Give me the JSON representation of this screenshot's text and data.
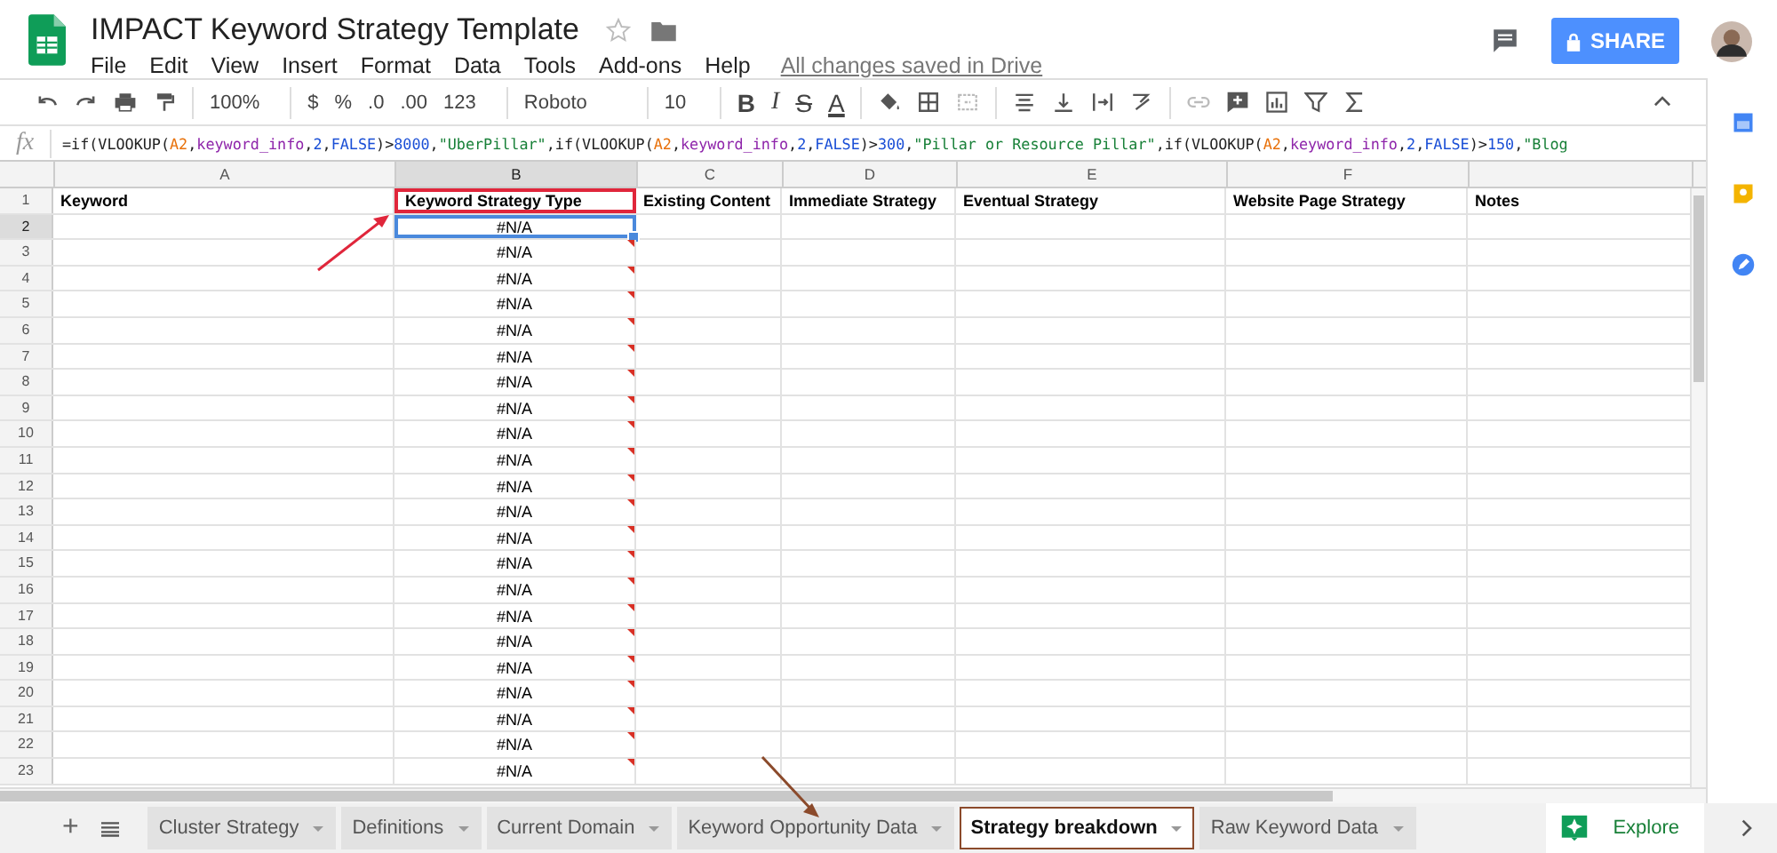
{
  "document": {
    "title": "IMPACT Keyword Strategy Template",
    "save_status": "All changes saved in Drive",
    "starred": false
  },
  "menu": [
    "File",
    "Edit",
    "View",
    "Insert",
    "Format",
    "Data",
    "Tools",
    "Add-ons",
    "Help"
  ],
  "share": {
    "label": "SHARE"
  },
  "toolbar": {
    "zoom": "100%",
    "currency": "$",
    "percent": "%",
    "decrease_decimals": ".0",
    "increase_decimals": ".00",
    "number_format": "123",
    "font": "Roboto",
    "font_size": "10",
    "bold": "B",
    "italic": "I",
    "strikethrough": "S",
    "text_color": "A"
  },
  "formula_bar": {
    "label": "fx",
    "segments": [
      {
        "kind": "plain",
        "text": "=if(VLOOKUP("
      },
      {
        "kind": "ref",
        "text": "A2"
      },
      {
        "kind": "plain",
        "text": ","
      },
      {
        "kind": "name",
        "text": "keyword_info"
      },
      {
        "kind": "plain",
        "text": ","
      },
      {
        "kind": "number",
        "text": "2"
      },
      {
        "kind": "plain",
        "text": ","
      },
      {
        "kind": "number",
        "text": "FALSE"
      },
      {
        "kind": "plain",
        "text": ")>"
      },
      {
        "kind": "number",
        "text": "8000"
      },
      {
        "kind": "plain",
        "text": ","
      },
      {
        "kind": "string",
        "text": "\"UberPillar\""
      },
      {
        "kind": "plain",
        "text": ",if(VLOOKUP("
      },
      {
        "kind": "ref",
        "text": "A2"
      },
      {
        "kind": "plain",
        "text": ","
      },
      {
        "kind": "name",
        "text": "keyword_info"
      },
      {
        "kind": "plain",
        "text": ","
      },
      {
        "kind": "number",
        "text": "2"
      },
      {
        "kind": "plain",
        "text": ","
      },
      {
        "kind": "number",
        "text": "FALSE"
      },
      {
        "kind": "plain",
        "text": ")>"
      },
      {
        "kind": "number",
        "text": "300"
      },
      {
        "kind": "plain",
        "text": ","
      },
      {
        "kind": "string",
        "text": "\"Pillar or Resource Pillar\""
      },
      {
        "kind": "plain",
        "text": ",if(VLOOKUP("
      },
      {
        "kind": "ref",
        "text": "A2"
      },
      {
        "kind": "plain",
        "text": ","
      },
      {
        "kind": "name",
        "text": "keyword_info"
      },
      {
        "kind": "plain",
        "text": ","
      },
      {
        "kind": "number",
        "text": "2"
      },
      {
        "kind": "plain",
        "text": ","
      },
      {
        "kind": "number",
        "text": "FALSE"
      },
      {
        "kind": "plain",
        "text": ")>"
      },
      {
        "kind": "number",
        "text": "150"
      },
      {
        "kind": "plain",
        "text": ","
      },
      {
        "kind": "string",
        "text": "\"Blog"
      }
    ]
  },
  "columns": [
    {
      "letter": "A",
      "selected": false
    },
    {
      "letter": "B",
      "selected": true
    },
    {
      "letter": "C",
      "selected": false
    },
    {
      "letter": "D",
      "selected": false
    },
    {
      "letter": "E",
      "selected": false
    },
    {
      "letter": "F",
      "selected": false
    }
  ],
  "header_row": {
    "number": "1",
    "cells": [
      "Keyword",
      "Keyword Strategy Type",
      "Existing Content",
      "Immediate Strategy",
      "Eventual Strategy",
      "Website Page Strategy",
      "Notes"
    ]
  },
  "rows": [
    {
      "number": "2",
      "value": "#N/A",
      "selected": true,
      "flagged": false
    },
    {
      "number": "3",
      "value": "#N/A",
      "selected": false,
      "flagged": true
    },
    {
      "number": "4",
      "value": "#N/A",
      "selected": false,
      "flagged": true
    },
    {
      "number": "5",
      "value": "#N/A",
      "selected": false,
      "flagged": true
    },
    {
      "number": "6",
      "value": "#N/A",
      "selected": false,
      "flagged": true
    },
    {
      "number": "7",
      "value": "#N/A",
      "selected": false,
      "flagged": true
    },
    {
      "number": "8",
      "value": "#N/A",
      "selected": false,
      "flagged": true
    },
    {
      "number": "9",
      "value": "#N/A",
      "selected": false,
      "flagged": true
    },
    {
      "number": "10",
      "value": "#N/A",
      "selected": false,
      "flagged": true
    },
    {
      "number": "11",
      "value": "#N/A",
      "selected": false,
      "flagged": true
    },
    {
      "number": "12",
      "value": "#N/A",
      "selected": false,
      "flagged": true
    },
    {
      "number": "13",
      "value": "#N/A",
      "selected": false,
      "flagged": true
    },
    {
      "number": "14",
      "value": "#N/A",
      "selected": false,
      "flagged": true
    },
    {
      "number": "15",
      "value": "#N/A",
      "selected": false,
      "flagged": true
    },
    {
      "number": "16",
      "value": "#N/A",
      "selected": false,
      "flagged": true
    },
    {
      "number": "17",
      "value": "#N/A",
      "selected": false,
      "flagged": true
    },
    {
      "number": "18",
      "value": "#N/A",
      "selected": false,
      "flagged": true
    },
    {
      "number": "19",
      "value": "#N/A",
      "selected": false,
      "flagged": true
    },
    {
      "number": "20",
      "value": "#N/A",
      "selected": false,
      "flagged": true
    },
    {
      "number": "21",
      "value": "#N/A",
      "selected": false,
      "flagged": true
    },
    {
      "number": "22",
      "value": "#N/A",
      "selected": false,
      "flagged": true
    },
    {
      "number": "23",
      "value": "#N/A",
      "selected": false,
      "flagged": true
    }
  ],
  "sheet_tabs": [
    {
      "label": "Cluster Strategy",
      "selected": false
    },
    {
      "label": "Definitions",
      "selected": false
    },
    {
      "label": "Current Domain",
      "selected": false
    },
    {
      "label": "Keyword Opportunity Data",
      "selected": false
    },
    {
      "label": "Strategy breakdown",
      "selected": true
    },
    {
      "label": "Raw Keyword Data",
      "selected": false
    }
  ],
  "add_sheet": {
    "label": "+"
  },
  "explore": {
    "label": "Explore"
  }
}
